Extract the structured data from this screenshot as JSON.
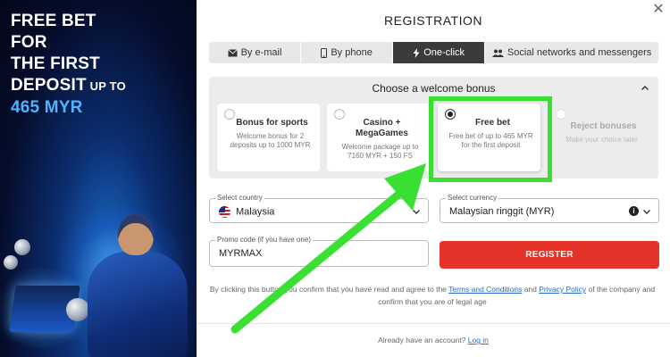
{
  "promo": {
    "line1": "FREE BET",
    "line2": "FOR",
    "line3": "THE FIRST",
    "line4": "DEPOSIT",
    "line4_small": " UP TO",
    "amount": "465 MYR",
    "amount_color": "#4fb3ff"
  },
  "window": {
    "title": "REGISTRATION",
    "close_icon": "close-icon"
  },
  "tabs": [
    {
      "label": "By e-mail",
      "icon": "envelope-icon",
      "active": false
    },
    {
      "label": "By phone",
      "icon": "phone-icon",
      "active": false
    },
    {
      "label": "One-click",
      "icon": "lightning-icon",
      "active": true
    },
    {
      "label": "Social networks and messengers",
      "icon": "people-icon",
      "active": false
    }
  ],
  "bonus": {
    "heading": "Choose a welcome bonus",
    "options": [
      {
        "title": "Bonus for sports",
        "desc": "Welcome bonus for 2 deposits up to 1000 MYR",
        "selected": false
      },
      {
        "title": "Casino + MegaGames",
        "desc": "Welcome package up to 7160 MYR + 150 FS",
        "selected": false
      },
      {
        "title": "Free bet",
        "desc": "Free bet of up to 465 MYR for the first deposit",
        "selected": true
      },
      {
        "title": "Reject bonuses",
        "desc": "Make your choice later",
        "selected": false
      }
    ]
  },
  "form": {
    "country_label": "Select country",
    "country_value": "Malaysia",
    "currency_label": "Select currency",
    "currency_value": "Malaysian ringgit (MYR)",
    "promo_label": "Promo code (if you have one)",
    "promo_value": "MYRMAX",
    "register_label": "REGISTER"
  },
  "terms": {
    "prefix": "By clicking this button you confirm that you have read and agree to the ",
    "terms_link": "Terms and Conditions",
    "and": " and ",
    "privacy_link": "Privacy Policy",
    "suffix": " of the company and confirm that you are of legal age"
  },
  "footer": {
    "question": "Already have an account? ",
    "login_link": "Log in"
  },
  "colors": {
    "accent_red": "#e63329",
    "highlight_green": "#39e032",
    "link_blue": "#2a6cc9"
  }
}
